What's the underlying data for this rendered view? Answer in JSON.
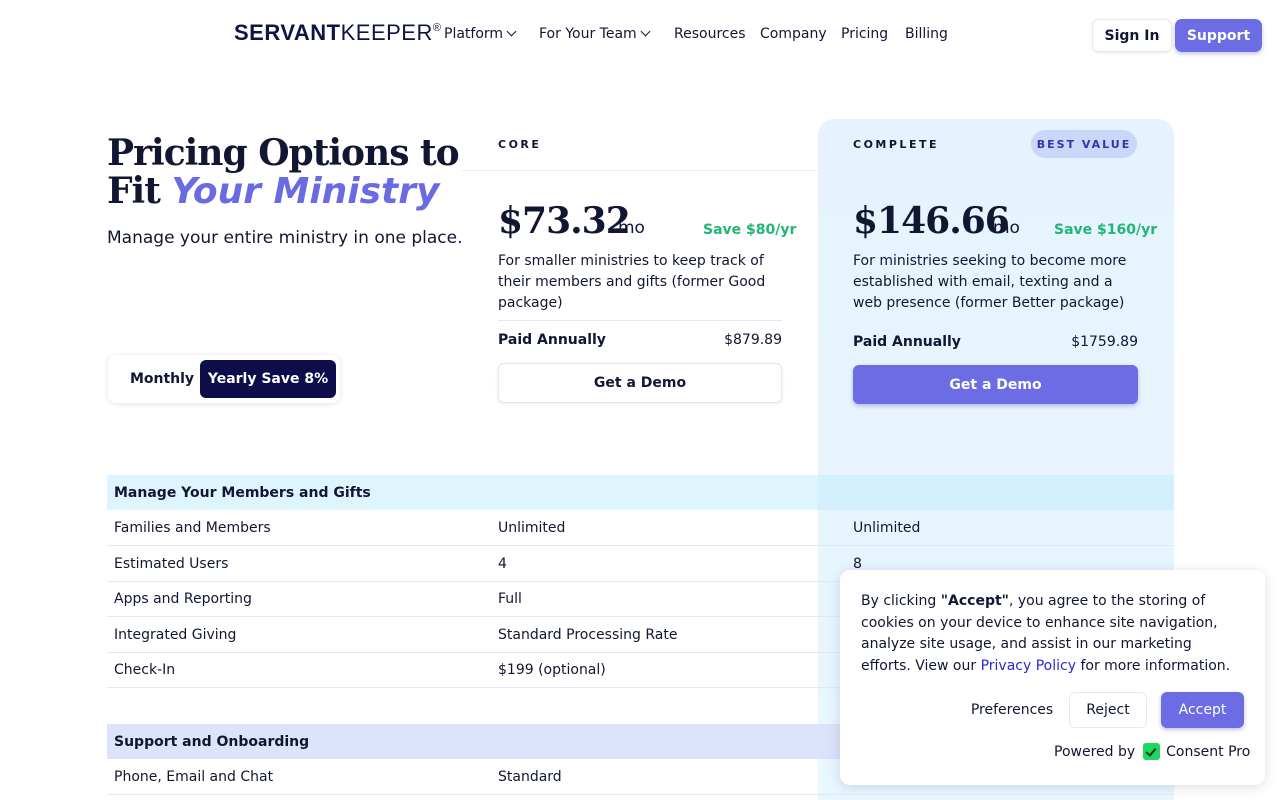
{
  "header": {
    "logo_bold": "SERVANT",
    "logo_thin": "KEEPER",
    "logo_mark": "®",
    "nav": {
      "platform": "Platform",
      "for_your_team": "For Your Team",
      "resources": "Resources",
      "company": "Company",
      "pricing": "Pricing",
      "billing": "Billing"
    },
    "sign_in": "Sign In",
    "support": "Support"
  },
  "hero": {
    "title_line1": "Pricing Options to",
    "title_line2_plain": "Fit",
    "title_line2_accent": "Your Ministry",
    "subtitle": "Manage your entire ministry in one place."
  },
  "billing_toggle": {
    "monthly": "Monthly",
    "yearly": "Yearly Save 8%"
  },
  "plans": {
    "core": {
      "label": "CORE",
      "price": "$73.32",
      "period": "mo",
      "save": "Save $80/yr",
      "description": "For smaller ministries to keep track of their members and gifts (former Good package)",
      "paid_label": "Paid Annually",
      "paid_value": "$879.89",
      "cta": "Get a Demo"
    },
    "complete": {
      "label": "COMPLETE",
      "badge": "BEST VALUE",
      "price": "$146.66",
      "period": "mo",
      "save": "Save $160/yr",
      "description": "For ministries seeking to become more established with email, texting and a web presence (former Better package)",
      "paid_label": "Paid Annually",
      "paid_value": "$1759.89",
      "cta": "Get a Demo"
    }
  },
  "features": {
    "section1": {
      "title": "Manage Your Members and Gifts",
      "rows": [
        {
          "name": "Families and Members",
          "core": "Unlimited",
          "complete": "Unlimited"
        },
        {
          "name": "Estimated Users",
          "core": "4",
          "complete": "8"
        },
        {
          "name": "Apps and Reporting",
          "core": "Full",
          "complete": ""
        },
        {
          "name": "Integrated Giving",
          "core": "Standard Processing Rate",
          "complete": ""
        },
        {
          "name": "Check-In",
          "core": "$199 (optional)",
          "complete": ""
        }
      ]
    },
    "section2": {
      "title": "Support and Onboarding",
      "rows": [
        {
          "name": "Phone, Email and Chat",
          "core": "Standard",
          "complete": ""
        }
      ]
    }
  },
  "cookie": {
    "text_prefix": "By clicking ",
    "accept_quoted": "\"Accept\"",
    "text_middle": ", you agree to the storing of cookies on your device to enhance site navigation, analyze site usage, and assist in our marketing efforts. View our ",
    "privacy_link": "Privacy Policy",
    "text_suffix": " for more information.",
    "preferences": "Preferences",
    "reject": "Reject",
    "accept": "Accept",
    "powered_by": "Powered by",
    "brand": "Consent Pro"
  },
  "colors": {
    "accent": "#6c6ce5",
    "navy": "#0c0d4a",
    "save_green": "#22b573",
    "complete_bg": "#e6f3fe"
  }
}
